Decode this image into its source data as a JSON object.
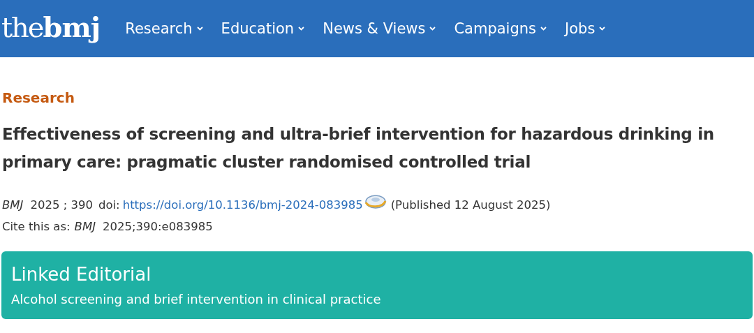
{
  "header": {
    "logo": {
      "light": "the",
      "bold": "bmj"
    },
    "nav": [
      {
        "label": "Research"
      },
      {
        "label": "Education"
      },
      {
        "label": "News & Views"
      },
      {
        "label": "Campaigns"
      },
      {
        "label": "Jobs"
      }
    ]
  },
  "article": {
    "section": "Research",
    "title": "Effectiveness of screening and ultra-brief intervention for hazardous drinking in primary care: pragmatic cluster randomised controlled trial",
    "meta": {
      "journal": "BMJ",
      "year_volume": "2025 ; 390",
      "doi_label": "doi:",
      "doi_link": "https://doi.org/10.1136/bmj-2024-083985",
      "published": "(Published 12 August 2025)"
    },
    "cite": {
      "label": "Cite this as:",
      "journal": "BMJ",
      "reference": "2025;390:e083985"
    }
  },
  "linked_editorial": {
    "heading": "Linked Editorial",
    "link": "Alcohol screening and brief intervention in clinical practice"
  }
}
